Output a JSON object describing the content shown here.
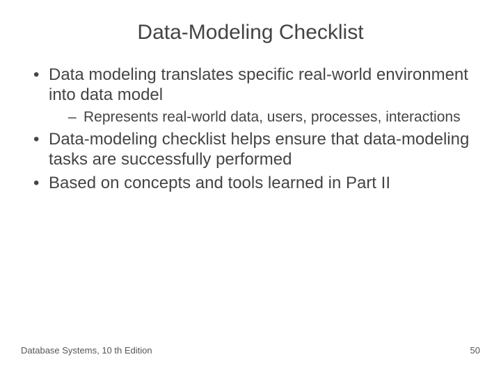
{
  "title": "Data-Modeling Checklist",
  "bullets": [
    {
      "text": "Data modeling translates specific real-world environment into data model",
      "sub": [
        {
          "text": "Represents real-world data, users, processes, interactions"
        }
      ]
    },
    {
      "text": "Data-modeling checklist helps ensure that data-modeling tasks are successfully performed",
      "sub": []
    },
    {
      "text": "Based on concepts and tools learned in Part II",
      "sub": []
    }
  ],
  "footer": {
    "left": "Database Systems, 10 th Edition",
    "right": "50"
  }
}
